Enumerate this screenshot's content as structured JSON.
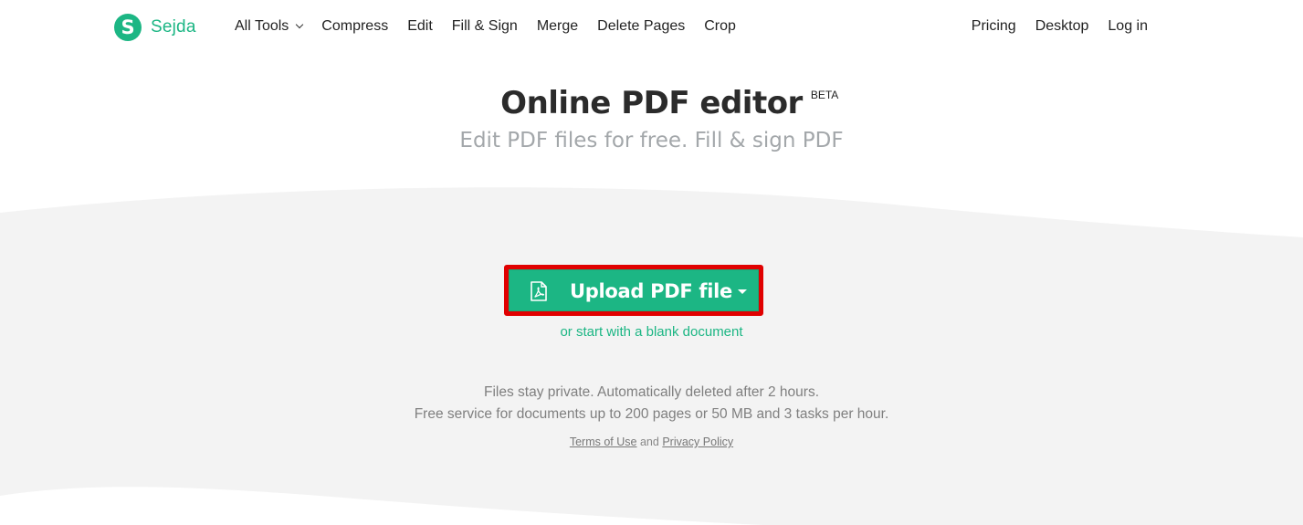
{
  "header": {
    "logo_letter": "S",
    "brand": "Sejda",
    "nav_left": [
      {
        "label": "All Tools",
        "has_dropdown": true
      },
      {
        "label": "Compress"
      },
      {
        "label": "Edit"
      },
      {
        "label": "Fill & Sign"
      },
      {
        "label": "Merge"
      },
      {
        "label": "Delete Pages"
      },
      {
        "label": "Crop"
      }
    ],
    "nav_right": [
      {
        "label": "Pricing"
      },
      {
        "label": "Desktop"
      },
      {
        "label": "Log in"
      }
    ]
  },
  "hero": {
    "title": "Online PDF editor",
    "badge": "BETA",
    "subtitle": "Edit PDF files for free. Fill & sign PDF"
  },
  "upload": {
    "button_label": "Upload PDF file",
    "icon": "pdf-file-icon",
    "dropdown_icon": "caret-down-icon",
    "blank_link": "or start with a blank document"
  },
  "info": {
    "line1": "Files stay private. Automatically deleted after 2 hours.",
    "line2": "Free service for documents up to 200 pages or 50 MB and 3 tasks per hour."
  },
  "legal": {
    "terms": "Terms of Use",
    "and": "and",
    "privacy": "Privacy Policy"
  },
  "colors": {
    "brand_green": "#1cb684",
    "highlight_red": "#e00000",
    "band_gray": "#f3f3f3",
    "subtitle_gray": "#a3a7aa"
  }
}
